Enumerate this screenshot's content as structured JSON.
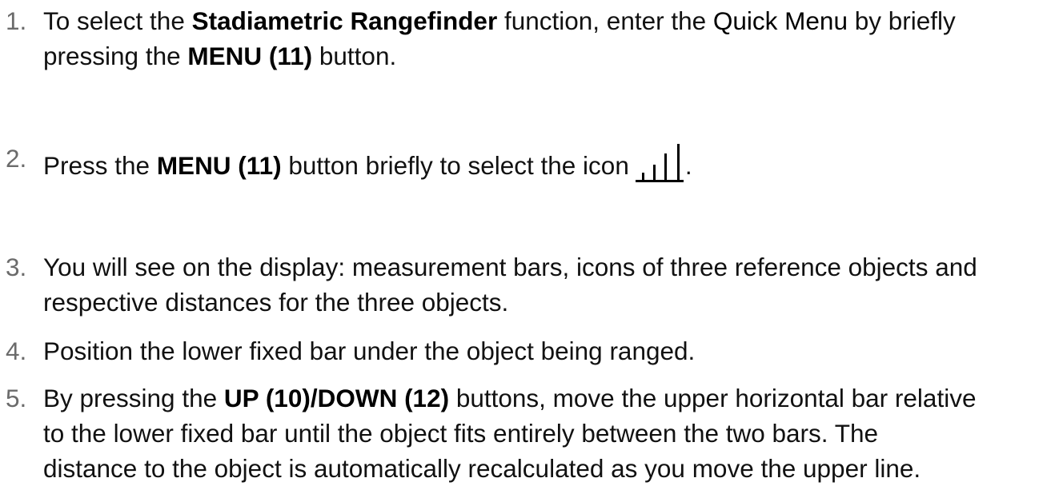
{
  "steps": [
    {
      "number": "1.",
      "line1": {
        "p1": "To select the ",
        "b1": "Stadiametric Rangefinder",
        "p2": " function, enter the ",
        "m1": "Quick Menu",
        "p3": " by briefly"
      },
      "line2": {
        "p1": "pressing the ",
        "b1": "MENU (11)",
        "p2": " button."
      }
    },
    {
      "number": "2.",
      "line1": {
        "p1": "Press the ",
        "b1": "MENU (11)",
        "p2": " button briefly to select the icon",
        "after_icon": ".",
        "icon": "signal-bars-icon"
      }
    },
    {
      "number": "3.",
      "line1": "You will see on the display: measurement bars, icons of three reference objects and",
      "line2": "respective distances for the three objects."
    },
    {
      "number": "4.",
      "line1": "Position the lower fixed bar under the object being ranged."
    },
    {
      "number": "5.",
      "line1": {
        "p1": "By pressing the ",
        "b1": "UP (10)/DOWN (12)",
        "p2": " buttons, move the upper horizontal bar relative"
      },
      "line2": "to the lower fixed bar until the object fits entirely between the two bars. The",
      "line3": "distance to the object is automatically recalculated as you move the upper line."
    }
  ]
}
